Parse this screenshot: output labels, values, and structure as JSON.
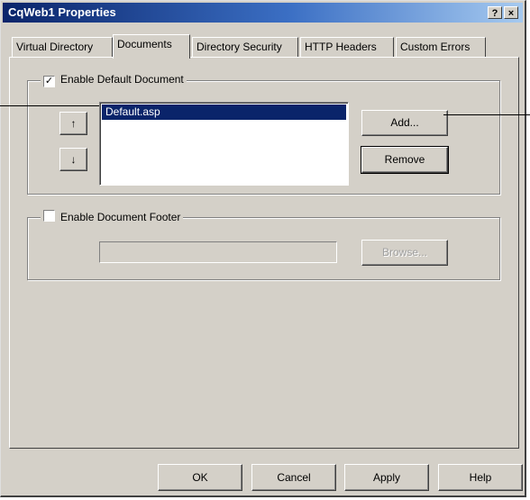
{
  "window": {
    "title": "CqWeb1 Properties",
    "help_label": "?",
    "close_label": "×"
  },
  "tabs": [
    {
      "label": "Virtual Directory",
      "active": false
    },
    {
      "label": "Documents",
      "active": true
    },
    {
      "label": "Directory Security",
      "active": false
    },
    {
      "label": "HTTP Headers",
      "active": false
    },
    {
      "label": "Custom Errors",
      "active": false
    }
  ],
  "default_document": {
    "legend": "Enable Default Document",
    "checked": true,
    "check_mark": "✓",
    "move_up_label": "↑",
    "move_down_label": "↓",
    "list_items": [
      "Default.asp"
    ],
    "add_label": "Add...",
    "remove_label": "Remove"
  },
  "document_footer": {
    "legend": "Enable Document Footer",
    "checked": false,
    "path_value": "",
    "browse_label": "Browse..."
  },
  "footer_buttons": {
    "ok": "OK",
    "cancel": "Cancel",
    "apply": "Apply",
    "help": "Help"
  }
}
